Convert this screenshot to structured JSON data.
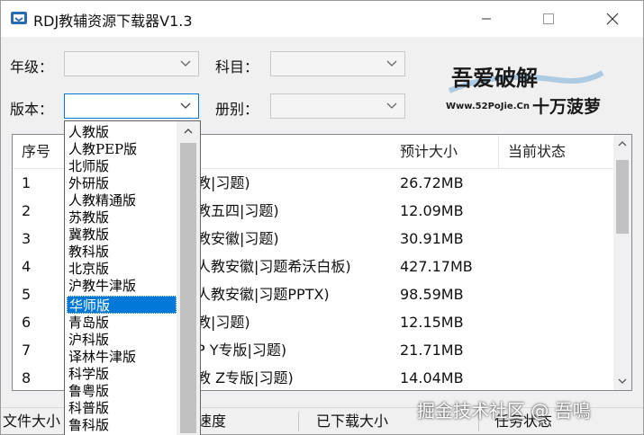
{
  "window": {
    "title": "RDJ教辅资源下载器V1.3"
  },
  "form": {
    "grade_label": "年级：",
    "subject_label": "科目：",
    "edition_label": "版本：",
    "volume_label": "册别："
  },
  "logo": {
    "line1": "吾爱破解",
    "url": "Www.52PoJie.Cn",
    "tagline": "十万菠萝"
  },
  "list": {
    "columns": [
      "序号",
      "预计大小",
      "当前状态"
    ],
    "rows": [
      {
        "no": "1",
        "name": "教|习题)",
        "size": "26.72MB"
      },
      {
        "no": "2",
        "name": "教五四|习题)",
        "size": "12.09MB"
      },
      {
        "no": "3",
        "name": "教安徽|习题)",
        "size": "30.91MB"
      },
      {
        "no": "4",
        "name": "人教安徽|习题希沃白板)",
        "size": "427.17MB"
      },
      {
        "no": "5",
        "name": "人教安徽|习题PPTX)",
        "size": "98.59MB"
      },
      {
        "no": "6",
        "name": "教|习题)",
        "size": "12.15MB"
      },
      {
        "no": "7",
        "name": "P Y专版|习题)",
        "size": "21.71MB"
      },
      {
        "no": "8",
        "name": "教 Z专版|习题)",
        "size": "14.04MB"
      }
    ]
  },
  "statusbar": {
    "file_size": "文件大小",
    "speed": "速度",
    "downloaded": "已下载大小",
    "task_status": "任务状态"
  },
  "watermark": "掘金技术社区 @ 吾鳴",
  "dropdown": {
    "items": [
      "人教版",
      "人教PEP版",
      "北师版",
      "外研版",
      "人教精通版",
      "苏教版",
      "冀教版",
      "教科版",
      "北京版",
      "沪教牛津版",
      "华师版",
      "青岛版",
      "沪科版",
      "译林牛津版",
      "科学版",
      "鲁粤版",
      "科普版",
      "鲁科版"
    ],
    "selected_index": 10
  }
}
